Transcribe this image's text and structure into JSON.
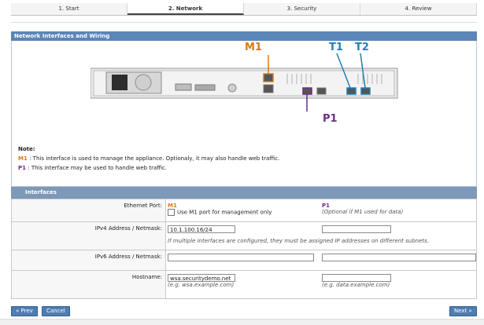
{
  "tabs": [
    {
      "label": "1. Start"
    },
    {
      "label": "2. Network"
    },
    {
      "label": "3. Security"
    },
    {
      "label": "4. Review"
    }
  ],
  "section_title": "Network Interfaces and Wiring",
  "diagram_labels": {
    "m1": "M1",
    "t1": "T1",
    "t2": "T2",
    "p1": "P1"
  },
  "note": {
    "title": "Note:",
    "m1_tag": "M1",
    "m1_text": ": This interface is used to manage the appliance. Optionaly, it may also handle web traffic.",
    "p1_tag": "P1",
    "p1_text": ": This interface may be used to handle web traffic."
  },
  "interfaces": {
    "title": "Interfaces",
    "ethernet": {
      "label": "Ethernet Port:",
      "m1": "M1",
      "m1_checkbox_label": "Use M1 port for management only",
      "p1": "P1",
      "p1_hint": "(Optional if M1 used for data)"
    },
    "ipv4": {
      "label": "IPv4 Address / Netmask:",
      "m1_value": "10.1.100.16/24",
      "p1_value": "",
      "hint": "If multiple interfaces are configured, they must be assigned IP addresses on different subnets."
    },
    "ipv6": {
      "label": "IPv6 Address / Netmask:",
      "m1_value": "",
      "p1_value": ""
    },
    "hostname": {
      "label": "Hostname:",
      "m1_value": "wsa.securitydemo.net",
      "m1_hint": "(e.g. wsa.example.com)",
      "p1_value": "",
      "p1_hint": "(e.g. data.example.com)"
    }
  },
  "buttons": {
    "prev": "« Prev",
    "cancel": "Cancel",
    "next": "Next »"
  },
  "colors": {
    "m1": "#d77a16",
    "t": "#1f7fb5",
    "p1": "#6b2d86",
    "header": "#5a86b8"
  }
}
